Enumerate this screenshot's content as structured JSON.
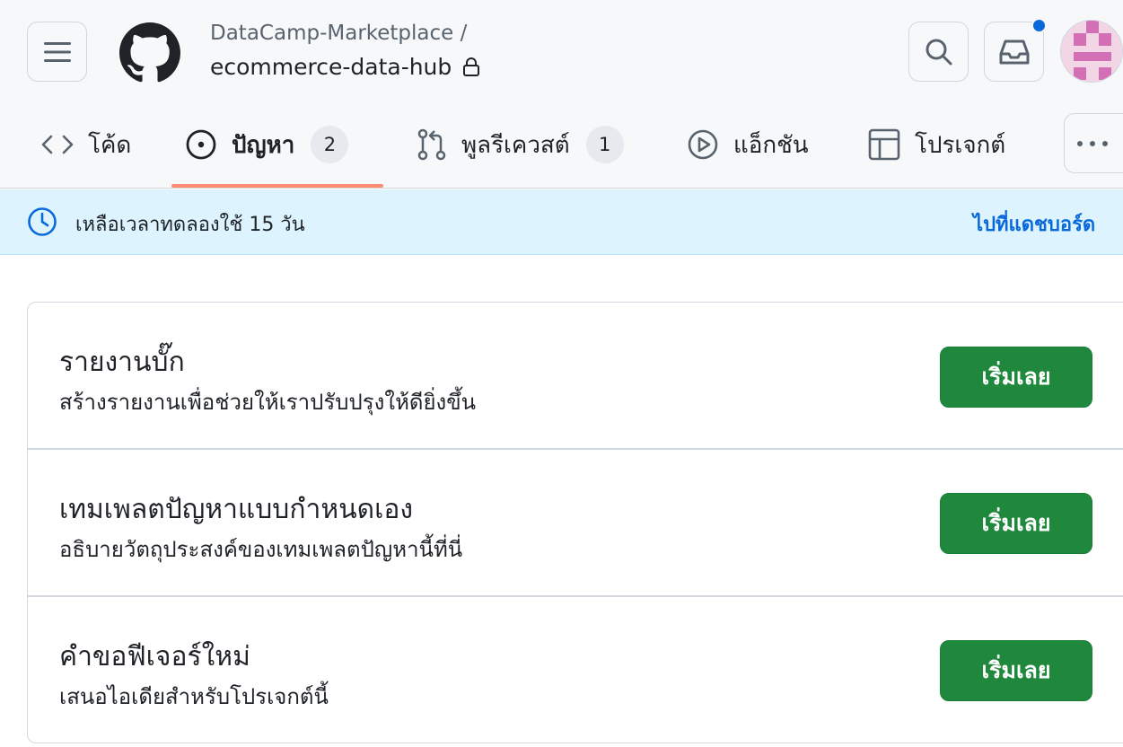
{
  "header": {
    "owner": "DataCamp-Marketplace /",
    "repo_name": "ecommerce-data-hub",
    "icons": {
      "menu": "hamburger-icon",
      "logo": "github-logo",
      "lock": "lock-icon",
      "search": "search-icon",
      "inbox": "inbox-icon",
      "notification_dot_color": "#0969da"
    }
  },
  "tabs": [
    {
      "label": "โค้ด",
      "icon": "code-icon",
      "counter": null,
      "active": false
    },
    {
      "label": "ปัญหา",
      "icon": "issue-icon",
      "counter": "2",
      "active": true
    },
    {
      "label": "พูลรีเควสต์",
      "icon": "pull-request-icon",
      "counter": "1",
      "active": false
    },
    {
      "label": "แอ็กชัน",
      "icon": "play-icon",
      "counter": null,
      "active": false
    },
    {
      "label": "โปรเจกต์",
      "icon": "table-icon",
      "counter": null,
      "active": false
    }
  ],
  "active_tab_color": "#fd8c73",
  "banner": {
    "text": "เหลือเวลาทดลองใช้ 15 วัน",
    "link": "ไปที่แดชบอร์ด",
    "icon": "clock-icon",
    "background": "#ddf4ff"
  },
  "templates": [
    {
      "title": "รายงานบั๊ก",
      "description": "สร้างรายงานเพื่อช่วยให้เราปรับปรุงให้ดียิ่งขึ้น",
      "button": "เริ่มเลย"
    },
    {
      "title": "เทมเพลตปัญหาแบบกำหนดเอง",
      "description": "อธิบายวัตถุประสงค์ของเทมเพลตปัญหานี้ที่นี่",
      "button": "เริ่มเลย"
    },
    {
      "title": "คำขอฟีเจอร์ใหม่",
      "description": "เสนอไอเดียสำหรับโปรเจกต์นี้",
      "button": "เริ่มเลย"
    }
  ],
  "button_color": "#1f883d"
}
